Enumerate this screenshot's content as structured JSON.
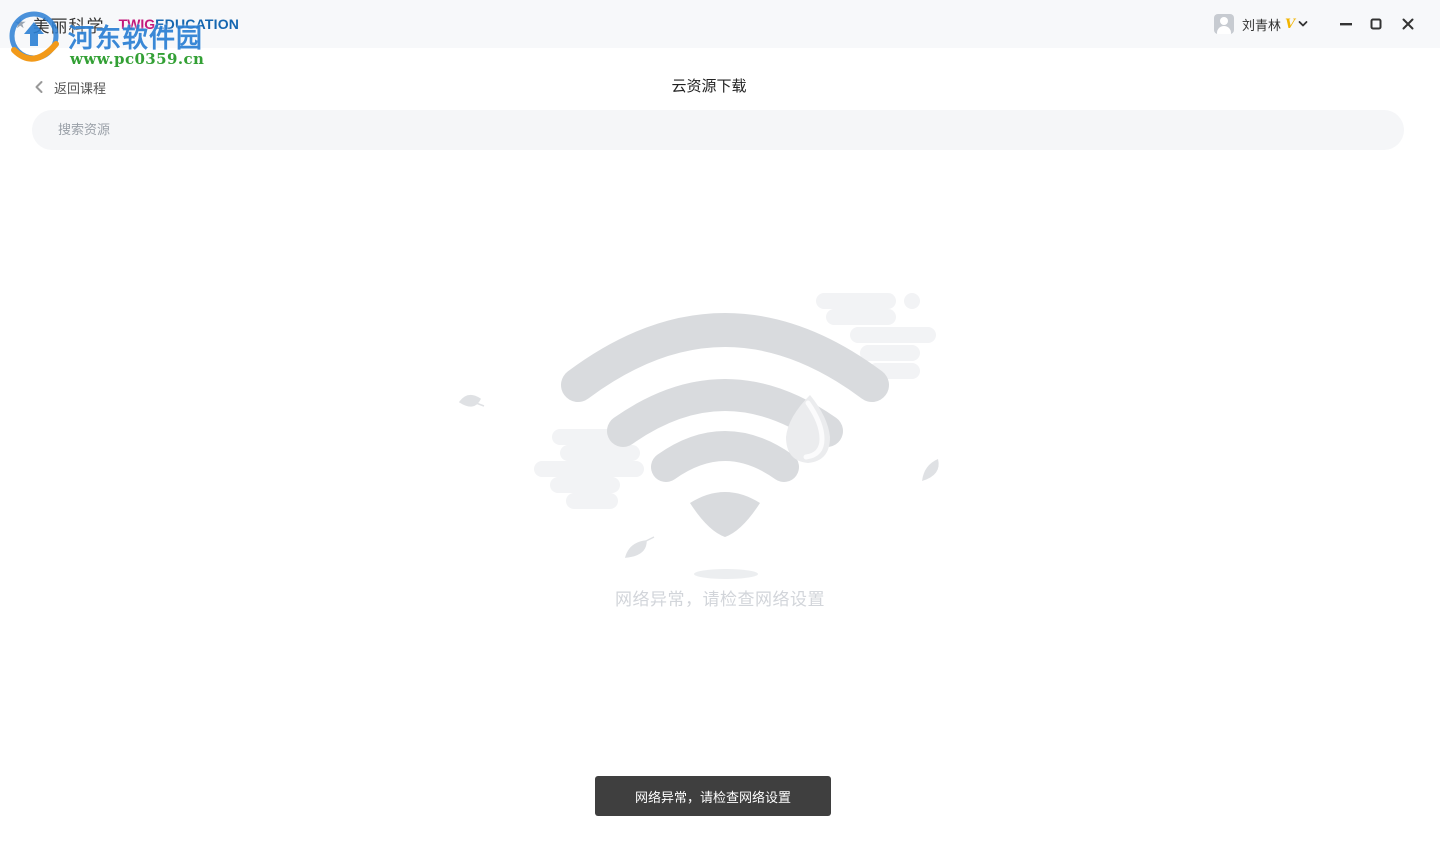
{
  "app": {
    "brand_cn": "美丽科学",
    "brand_twig": "TWIG",
    "brand_edu": "EDUCATION"
  },
  "watermark": {
    "text_cn": "河东软件园",
    "url": "www.pc0359.cn"
  },
  "user": {
    "name": "刘青林",
    "vip_badge": "V"
  },
  "header": {
    "back_label": "返回课程",
    "title": "云资源下载"
  },
  "search": {
    "placeholder": "搜索资源",
    "value": ""
  },
  "empty_state": {
    "icon": "wifi-error-icon",
    "message": "网络异常，请检查网络设置"
  },
  "toast": {
    "message": "网络异常，请检查网络设置"
  },
  "colors": {
    "titlebar_bg": "#f7f8fa",
    "search_bg": "#f5f6f8",
    "toast_bg": "#3f3f3f",
    "brand_magenta": "#c2187a",
    "brand_blue": "#1466b0",
    "vip_gold": "#f2b400"
  }
}
